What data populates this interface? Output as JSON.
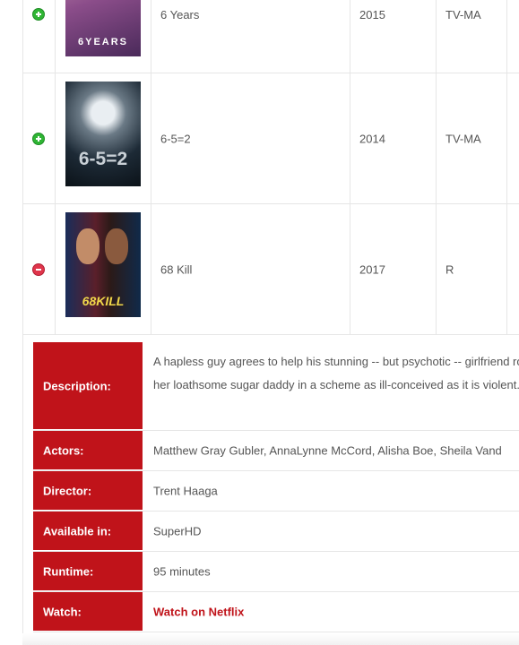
{
  "movies": [
    {
      "title": "6 Years",
      "year": "2015",
      "rating": "TV-MA",
      "state": "collapsed",
      "poster_text": "6YEARS",
      "toggle_icon": "plus-circle-icon"
    },
    {
      "title": "6-5=2",
      "year": "2014",
      "rating": "TV-MA",
      "state": "collapsed",
      "poster_text": "6-5=2",
      "toggle_icon": "plus-circle-icon"
    },
    {
      "title": "68 Kill",
      "year": "2017",
      "rating": "R",
      "state": "expanded",
      "poster_text": "68KILL",
      "toggle_icon": "minus-circle-icon"
    }
  ],
  "details": {
    "description_label": "Description:",
    "description": "A hapless guy agrees to help his stunning -- but psychotic -- girlfriend rob her loathsome sugar daddy in a scheme as ill-conceived as it is violent.",
    "actors_label": "Actors:",
    "actors": "Matthew Gray Gubler, AnnaLynne McCord, Alisha Boe, Sheila Vand",
    "director_label": "Director:",
    "director": "Trent Haaga",
    "available_label": "Available in:",
    "available": "SuperHD",
    "runtime_label": "Runtime:",
    "runtime": "95 minutes",
    "watch_label": "Watch:",
    "watch_link": "Watch on Netflix"
  },
  "colors": {
    "label_bg": "#c0131a",
    "plus_icon": "#2fb534",
    "minus_icon": "#e0354b",
    "link": "#c0131a"
  }
}
